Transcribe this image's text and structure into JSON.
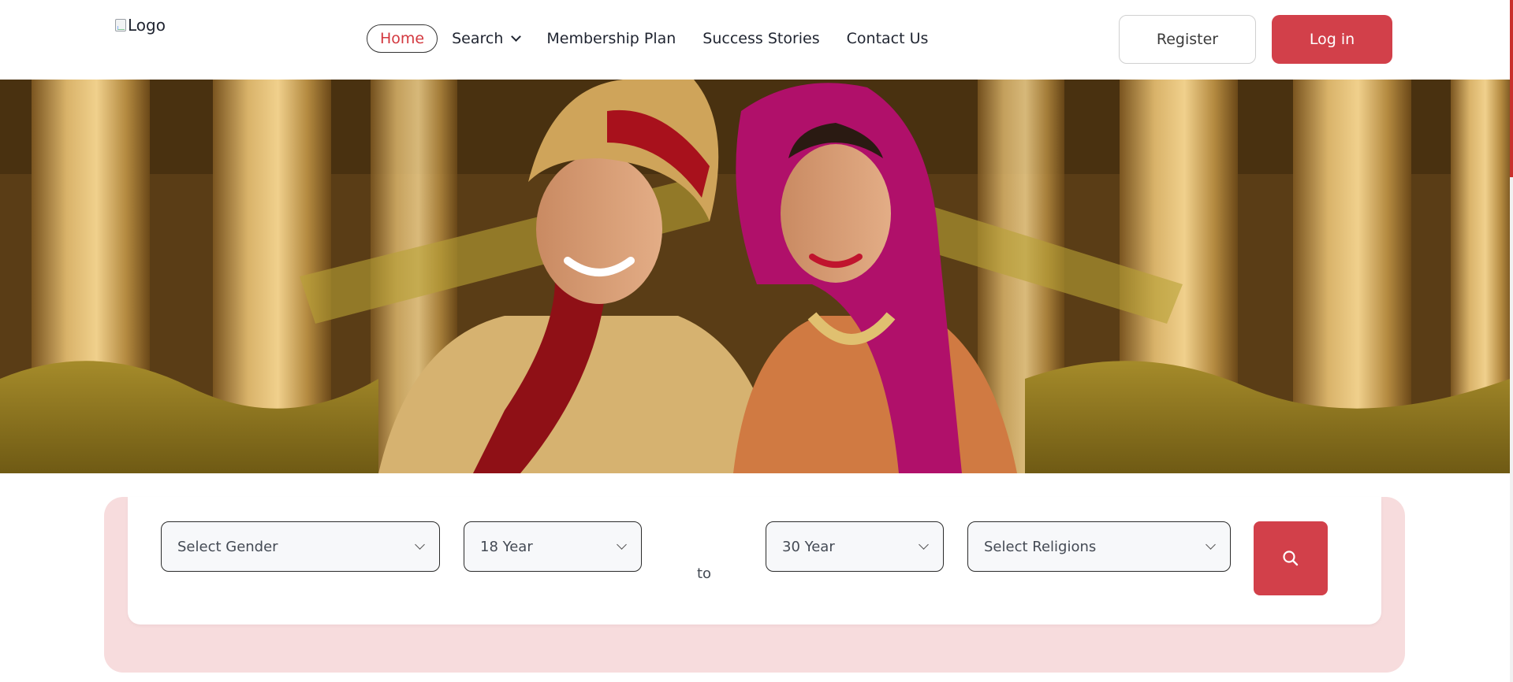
{
  "header": {
    "logo_alt": "Logo",
    "nav": [
      {
        "label": "Home",
        "active": true
      },
      {
        "label": "Search",
        "has_dropdown": true
      },
      {
        "label": "Membership Plan"
      },
      {
        "label": "Success Stories"
      },
      {
        "label": "Contact Us"
      }
    ],
    "register_label": "Register",
    "login_label": "Log in"
  },
  "hero": {
    "image_icon": "wedding-couple-hero-image"
  },
  "search": {
    "gender_placeholder": "Select Gender",
    "age_min": "18 Year",
    "to_label": "to",
    "age_max": "30 Year",
    "religion_placeholder": "Select Religions",
    "search_icon": "search-icon"
  },
  "colors": {
    "brand_red": "#d2404a",
    "active_nav_text": "#d3383f",
    "search_panel_bg": "#f7dcdd"
  }
}
